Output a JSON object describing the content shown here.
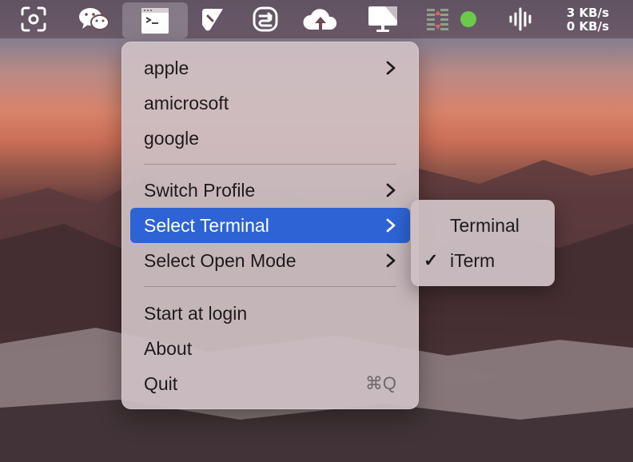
{
  "menubar": {
    "items": [
      {
        "icon": "screenshot-icon"
      },
      {
        "icon": "wechat-icon"
      },
      {
        "icon": "terminal-window-icon"
      },
      {
        "icon": "shape-tool-icon"
      },
      {
        "icon": "sync-app-icon"
      },
      {
        "icon": "cloud-upload-icon"
      },
      {
        "icon": "display-icon"
      },
      {
        "icon": "equalizer-icon"
      },
      {
        "icon": "status-dot-icon",
        "color": "#6cc94a"
      },
      {
        "icon": "audio-waveform-icon"
      }
    ],
    "network": {
      "upload": "3 KB/s",
      "download": "0 KB/s"
    }
  },
  "menu": {
    "items": [
      {
        "label": "apple",
        "submenu": true
      },
      {
        "label": "amicrosoft"
      },
      {
        "label": "google"
      },
      {
        "label": "Switch Profile",
        "submenu": true
      },
      {
        "label": "Select Terminal",
        "submenu": true,
        "highlighted": true
      },
      {
        "label": "Select Open Mode",
        "submenu": true
      },
      {
        "label": "Start at login"
      },
      {
        "label": "About"
      },
      {
        "label": "Quit",
        "shortcut": "⌘Q"
      }
    ],
    "highlight_color": "#2d63d4"
  },
  "submenu": {
    "items": [
      {
        "label": "Terminal",
        "checked": false
      },
      {
        "label": "iTerm",
        "checked": true,
        "check": "✓"
      }
    ]
  }
}
